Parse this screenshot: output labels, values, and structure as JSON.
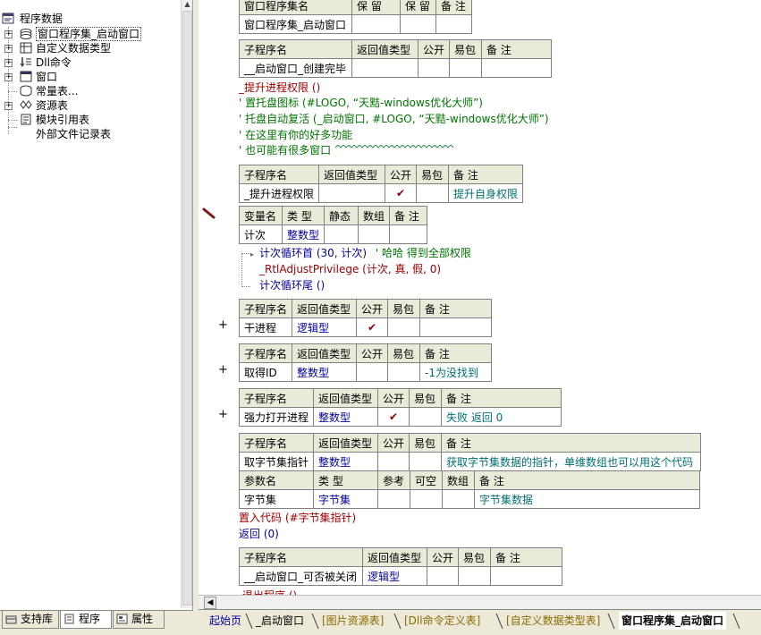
{
  "tree": {
    "root": "程序数据",
    "items": [
      {
        "label": "窗口程序集_启动窗口",
        "expander": "+",
        "icon": "assembly-icon",
        "selected": true
      },
      {
        "label": "自定义数据类型",
        "expander": "+",
        "icon": "datatype-icon"
      },
      {
        "label": "Dll命令",
        "expander": "+",
        "icon": "dll-icon"
      },
      {
        "label": "窗口",
        "expander": "+",
        "icon": "window-icon"
      },
      {
        "label": "常量表...",
        "expander": "",
        "icon": "constant-icon"
      },
      {
        "label": "资源表",
        "expander": "+",
        "icon": "resource-icon"
      },
      {
        "label": "模块引用表",
        "expander": "",
        "icon": "module-icon"
      },
      {
        "label": "外部文件记录表",
        "expander": "",
        "icon": "file-icon"
      }
    ]
  },
  "left_tabs": [
    {
      "label": "支持库",
      "icon": "library-icon"
    },
    {
      "label": "程序",
      "icon": "program-icon",
      "active": true
    },
    {
      "label": "属性",
      "icon": "property-icon"
    }
  ],
  "assembly_table": {
    "headers": [
      "窗口程序集名",
      "保 留",
      "保 留",
      "备 注"
    ],
    "row": [
      "窗口程序集_启动窗口",
      "",
      "",
      ""
    ]
  },
  "sub1": {
    "headers": [
      "子程序名",
      "返回值类型",
      "公开",
      "易包",
      "备 注"
    ],
    "row": [
      "__启动窗口_创建完毕",
      "",
      "",
      "",
      ""
    ]
  },
  "code_lines_1": [
    {
      "text": "_提升进程权限 ()",
      "color": "red"
    },
    {
      "text": "' 置托盘图标 (#LOGO, “天黠-windows优化大师”)",
      "color": "green"
    },
    {
      "text": "' 托盘自动复活 (_启动窗口, #LOGO, “天黠-windows优化大师”)",
      "color": "green"
    },
    {
      "text": "' 在这里有你的好多功能",
      "color": "green"
    },
    {
      "text": "' 也可能有很多窗口",
      "color": "green"
    }
  ],
  "sub2": {
    "headers": [
      "子程序名",
      "返回值类型",
      "公开",
      "易包",
      "备 注"
    ],
    "row": [
      "_提升进程权限",
      "",
      "✔",
      "",
      "提升自身权限"
    ]
  },
  "var_table": {
    "headers": [
      "变量名",
      "类 型",
      "静态",
      "数组",
      "备 注"
    ],
    "row": [
      "计次",
      "整数型",
      "",
      "",
      ""
    ]
  },
  "loop": {
    "head": "计次循环首 (30, 计次)",
    "head_comment": "' 哈哈 得到全部权限",
    "body": "_RtlAdjustPrivilege (计次, 真, 假, 0)",
    "tail": "计次循环尾 ()"
  },
  "sub3": {
    "headers": [
      "子程序名",
      "返回值类型",
      "公开",
      "易包",
      "备 注"
    ],
    "row": [
      "干进程",
      "逻辑型",
      "✔",
      "",
      ""
    ]
  },
  "sub4": {
    "headers": [
      "子程序名",
      "返回值类型",
      "公开",
      "易包",
      "备 注"
    ],
    "row": [
      "取得ID",
      "整数型",
      "",
      "",
      "-1为没找到"
    ]
  },
  "sub5": {
    "headers": [
      "子程序名",
      "返回值类型",
      "公开",
      "易包",
      "备 注"
    ],
    "row": [
      "强力打开进程",
      "整数型",
      "✔",
      "",
      "失败 返回 0"
    ]
  },
  "sub6": {
    "headers": [
      "子程序名",
      "返回值类型",
      "公开",
      "易包",
      "备 注"
    ],
    "row": [
      "取字节集指针",
      "整数型",
      "",
      "",
      "获取字节集数据的指针，单维数组也可以用这个代码"
    ],
    "param_headers": [
      "参数名",
      "类 型",
      "参考",
      "可空",
      "数组",
      "备 注"
    ],
    "param_row": [
      "字节集",
      "字节集",
      "",
      "",
      "",
      "字节集数据"
    ]
  },
  "code_lines_2": [
    {
      "text": "置入代码 (#字节集指针)",
      "color": "red"
    },
    {
      "text": "返回 (0)",
      "color": "blue"
    }
  ],
  "sub7": {
    "headers": [
      "子程序名",
      "返回值类型",
      "公开",
      "易包",
      "备 注"
    ],
    "row": [
      "__启动窗口_可否被关闭",
      "逻辑型",
      "",
      "",
      ""
    ]
  },
  "cut_line": "退出程序 ()",
  "doc_tabs": [
    {
      "label": "起始页",
      "state": "first"
    },
    {
      "label": "_启动窗口",
      "state": "normal"
    },
    {
      "label": "[图片资源表]",
      "state": "inactive"
    },
    {
      "label": "[Dll命令定义表]",
      "state": "inactive"
    },
    {
      "label": "[自定义数据类型表]",
      "state": "inactive"
    },
    {
      "label": "窗口程序集_启动窗口",
      "state": "active"
    }
  ],
  "colors": {
    "header_bg": "#e7ecd9",
    "keyword_blue": "#00009c",
    "call_red": "#a00000",
    "comment_green": "#007400"
  }
}
